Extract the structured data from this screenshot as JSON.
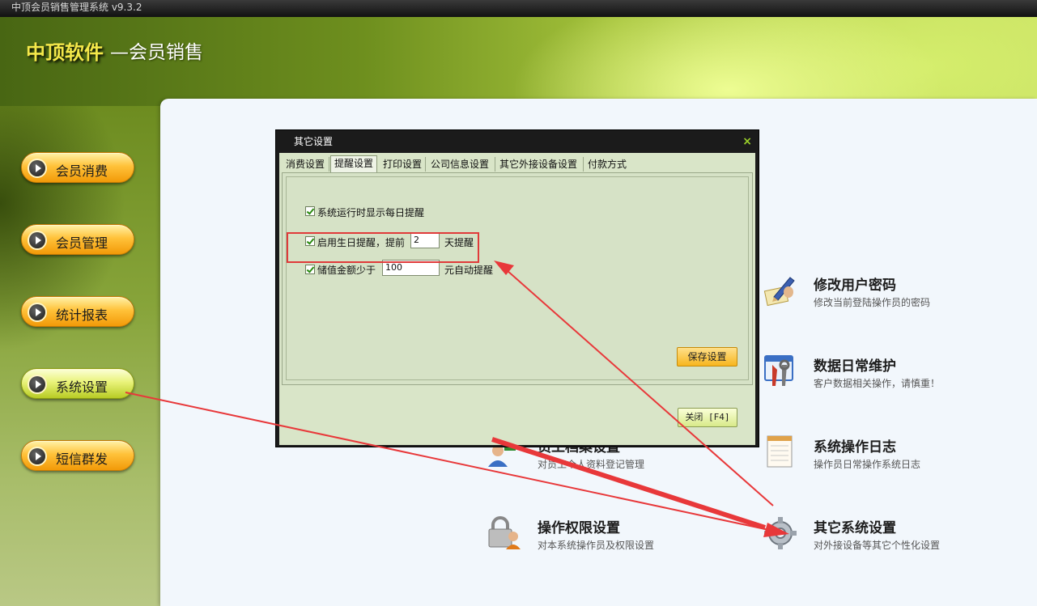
{
  "window": {
    "title": "中顶会员销售管理系统 v9.3.2"
  },
  "header": {
    "brand": "中顶软件",
    "subtitle": "—会员销售"
  },
  "sidebar": {
    "items": [
      {
        "label": "会员消费",
        "active": false
      },
      {
        "label": "会员管理",
        "active": false
      },
      {
        "label": "统计报表",
        "active": false
      },
      {
        "label": "系统设置",
        "active": true
      },
      {
        "label": "短信群发",
        "active": false
      }
    ]
  },
  "tiles": [
    {
      "title": "修改用户密码",
      "desc": "修改当前登陆操作员的密码",
      "icon": "pen-edit-icon"
    },
    {
      "title": "数据日常维护",
      "desc": "客户数据相关操作，请慎重！",
      "icon": "tools-window-icon"
    },
    {
      "title": "员工档案设置",
      "desc": "对员工个人资料登记管理",
      "icon": "staff-users-icon"
    },
    {
      "title": "系统操作日志",
      "desc": "操作员日常操作系统日志",
      "icon": "notepad-icon"
    },
    {
      "title": "操作权限设置",
      "desc": "对本系统操作员及权限设置",
      "icon": "lock-user-icon"
    },
    {
      "title": "其它系统设置",
      "desc": "对外接设备等其它个性化设置",
      "icon": "gear-icon"
    }
  ],
  "dialog": {
    "title": "其它设置",
    "close_glyph": "×",
    "tabs": [
      "消费设置",
      "提醒设置",
      "打印设置",
      "公司信息设置",
      "其它外接设备设置",
      "付款方式"
    ],
    "active_tab": "提醒设置",
    "options": {
      "daily_reminder": {
        "label": "系统运行时显示每日提醒",
        "checked": true
      },
      "birthday": {
        "label": "启用生日提醒，提前",
        "checked": true,
        "days": "2",
        "suffix": "天提醒"
      },
      "balance": {
        "label": "储值金额少于",
        "checked": true,
        "amount": "100",
        "suffix": "元自动提醒"
      }
    },
    "save_label": "保存设置",
    "close_label": "关闭 [F4]"
  },
  "colors": {
    "annotation": "#e8383a",
    "accent_orange": "#f7b51f",
    "accent_green": "#b8cc25"
  }
}
